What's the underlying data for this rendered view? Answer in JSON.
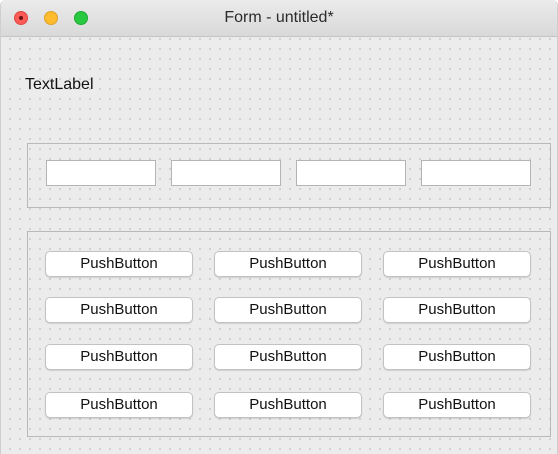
{
  "window": {
    "title": "Form - untitled*"
  },
  "form": {
    "text_label": "TextLabel",
    "line_edits": [
      "",
      "",
      "",
      ""
    ],
    "push_buttons": [
      [
        "PushButton",
        "PushButton",
        "PushButton"
      ],
      [
        "PushButton",
        "PushButton",
        "PushButton"
      ],
      [
        "PushButton",
        "PushButton",
        "PushButton"
      ],
      [
        "PushButton",
        "PushButton",
        "PushButton"
      ]
    ]
  },
  "colors": {
    "close": "#fc5b57",
    "minimize": "#fdbc2e",
    "maximize": "#28c840",
    "canvas": "#ececec"
  }
}
